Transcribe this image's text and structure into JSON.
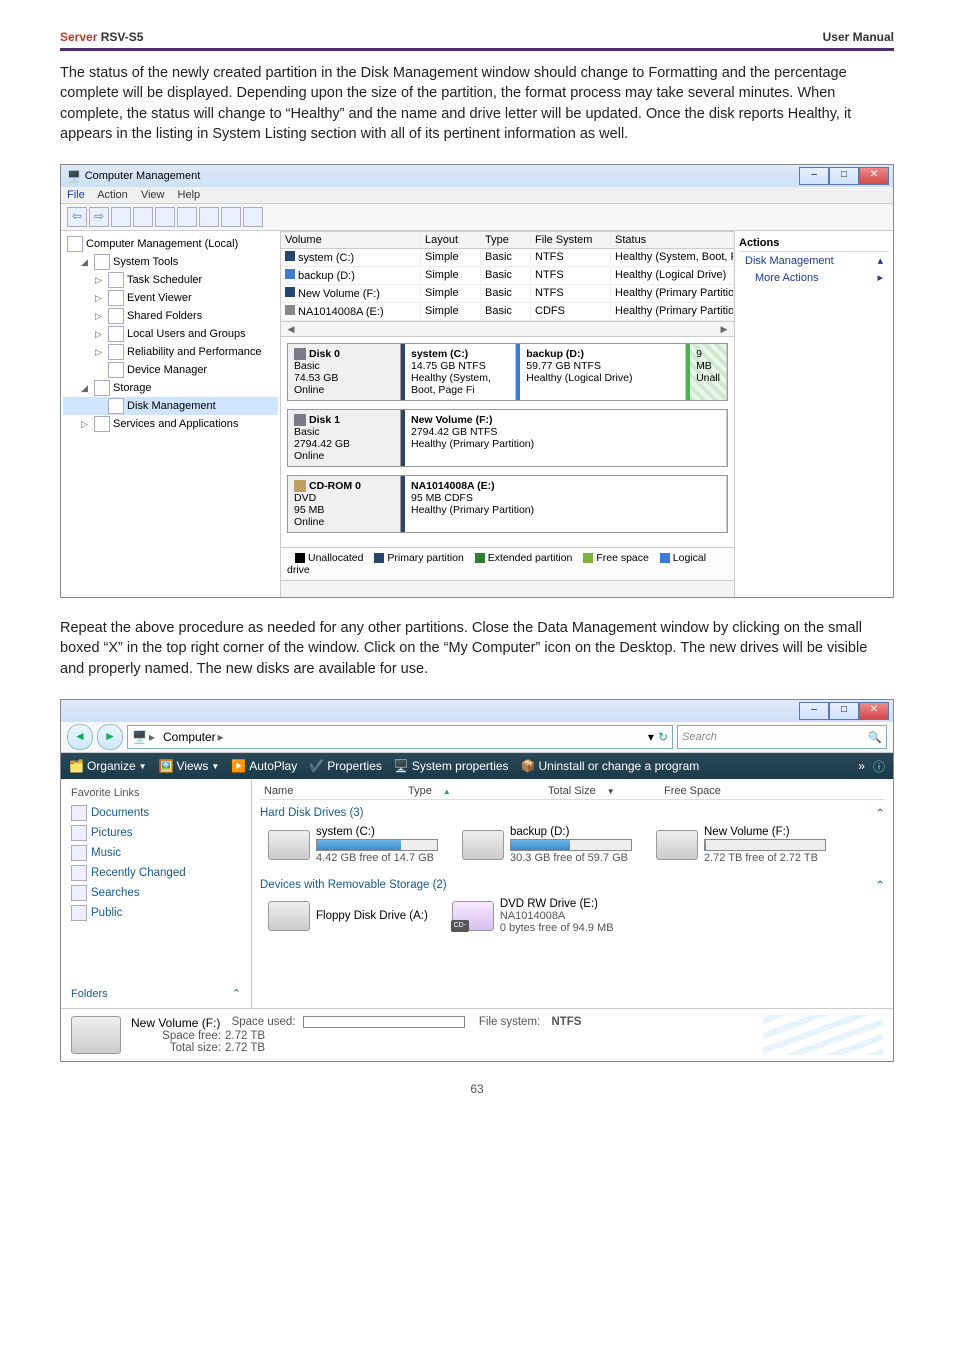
{
  "doc": {
    "productLabel": "Server",
    "modelLabel": "RSV-S5",
    "rightHeader": "User Manual",
    "para1": "The status of the newly created partition in the Disk Management window should change to Formatting and the percentage complete will be displayed. Depending upon the size of the partition, the format process may take several minutes. When complete, the status will change to “Healthy” and the name and drive letter will be updated. Once the disk reports Healthy, it appears in the listing in System Listing section with all of its pertinent information as well.",
    "para2": "Repeat the above procedure as needed for any other partitions. Close the Data Management window by clicking on the small boxed “X” in the top right corner of the window. Click on the “My Computer” icon on the Desktop. The new drives will be visible and properly named. The new disks are available for use.",
    "pageNumber": "63"
  },
  "cm": {
    "title": "Computer Management",
    "menu": {
      "file": "File",
      "action": "Action",
      "view": "View",
      "help": "Help"
    },
    "tree": {
      "root": "Computer Management (Local)",
      "systemTools": "System Tools",
      "taskScheduler": "Task Scheduler",
      "eventViewer": "Event Viewer",
      "sharedFolders": "Shared Folders",
      "localUsers": "Local Users and Groups",
      "reliability": "Reliability and Performance",
      "deviceManager": "Device Manager",
      "storage": "Storage",
      "diskManagement": "Disk Management",
      "services": "Services and Applications"
    },
    "volHeader": {
      "volume": "Volume",
      "layout": "Layout",
      "type": "Type",
      "fs": "File System",
      "status": "Status"
    },
    "vols": [
      {
        "name": "system (C:)",
        "layout": "Simple",
        "type": "Basic",
        "fs": "NTFS",
        "status": "Healthy (System, Boot, Page File, Active, Crash Dump, Primary Partition)",
        "color": "#26466d"
      },
      {
        "name": "backup (D:)",
        "layout": "Simple",
        "type": "Basic",
        "fs": "NTFS",
        "status": "Healthy (Logical Drive)",
        "color": "#3a7bd5"
      },
      {
        "name": "New Volume (F:)",
        "layout": "Simple",
        "type": "Basic",
        "fs": "NTFS",
        "status": "Healthy (Primary Partition)",
        "color": "#26466d"
      },
      {
        "name": "NA1014008A (E:)",
        "layout": "Simple",
        "type": "Basic",
        "fs": "CDFS",
        "status": "Healthy (Primary Partition)",
        "color": "#888"
      }
    ],
    "disks": [
      {
        "label": "Disk 0",
        "meta1": "Basic",
        "meta2": "74.53 GB",
        "meta3": "Online",
        "iconColor": "#7a7a8a",
        "parts": [
          {
            "name": "system (C:)",
            "size": "14.75 GB NTFS",
            "state": "Healthy (System, Boot, Page Fi",
            "cls": "",
            "w": "36%"
          },
          {
            "name": "backup (D:)",
            "size": "59.77 GB NTFS",
            "state": "Healthy (Logical Drive)",
            "cls": "logical",
            "w": "56%"
          },
          {
            "name": "",
            "size": "9 MB",
            "state": "Unall",
            "cls": "free",
            "w": "8%"
          }
        ]
      },
      {
        "label": "Disk 1",
        "meta1": "Basic",
        "meta2": "2794.42 GB",
        "meta3": "Online",
        "iconColor": "#7a7a8a",
        "parts": [
          {
            "name": "New Volume (F:)",
            "size": "2794.42 GB NTFS",
            "state": "Healthy (Primary Partition)",
            "cls": "",
            "w": "100%"
          }
        ]
      },
      {
        "label": "CD-ROM 0",
        "meta1": "DVD",
        "meta2": "95 MB",
        "meta3": "Online",
        "iconColor": "#c0a060",
        "parts": [
          {
            "name": "NA1014008A (E:)",
            "size": "95 MB CDFS",
            "state": "Healthy (Primary Partition)",
            "cls": "",
            "w": "100%"
          }
        ]
      }
    ],
    "legend": {
      "unalloc": "Unallocated",
      "primary": "Primary partition",
      "extended": "Extended partition",
      "free": "Free space",
      "logical": "Logical drive"
    },
    "actions": {
      "header": "Actions",
      "dm": "Disk Management",
      "more": "More Actions"
    }
  },
  "ex": {
    "breadcrumb": {
      "computer": "Computer"
    },
    "searchPlaceholder": "Search",
    "toolbar": {
      "organize": "Organize",
      "views": "Views",
      "autoplay": "AutoPlay",
      "properties": "Properties",
      "sysProps": "System properties",
      "uninstall": "Uninstall or change a program"
    },
    "cols": {
      "name": "Name",
      "type": "Type",
      "totalSize": "Total Size",
      "freeSpace": "Free Space"
    },
    "sidebar": {
      "header": "Favorite Links",
      "documents": "Documents",
      "pictures": "Pictures",
      "music": "Music",
      "recently": "Recently Changed",
      "searches": "Searches",
      "public": "Public",
      "folders": "Folders"
    },
    "groupHdd": "Hard Disk Drives (3)",
    "groupRem": "Devices with Removable Storage (2)",
    "drives": {
      "c": {
        "name": "system (C:)",
        "free": "4.42 GB free of 14.7 GB",
        "pct": 70
      },
      "d": {
        "name": "backup (D:)",
        "free": "30.3 GB free of 59.7 GB",
        "pct": 49
      },
      "f": {
        "name": "New Volume (F:)",
        "free": "2.72 TB free of 2.72 TB",
        "pct": 1
      },
      "a": {
        "name": "Floppy Disk Drive (A:)"
      },
      "e": {
        "name": "DVD RW Drive (E:)",
        "sub": "NA1014008A",
        "free": "0 bytes free of 94.9 MB",
        "badge": "CD-ROM"
      }
    },
    "details": {
      "title": "New Volume (F:)",
      "spaceUsedLabel": "Space used:",
      "fsLabel": "File system:",
      "fs": "NTFS",
      "spaceFreeLabel": "Space free:",
      "spaceFree": "2.72 TB",
      "totalLabel": "Total size:",
      "total": "2.72 TB"
    }
  }
}
